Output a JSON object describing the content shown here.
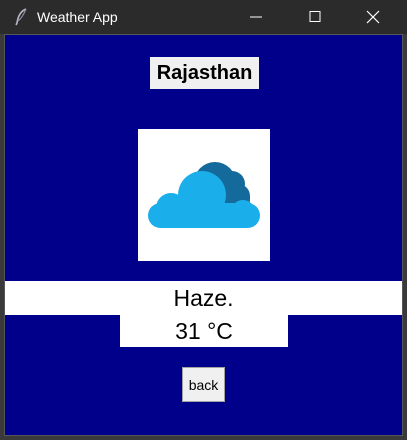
{
  "window": {
    "title": "Weather App",
    "icon": "feather-icon",
    "controls": [
      "minimize-icon",
      "maximize-icon",
      "close-icon"
    ]
  },
  "weather": {
    "city": "Rajasthan",
    "condition": "Haze.",
    "temperature": "31 °C",
    "icon": "cloud-icon"
  },
  "buttons": {
    "back_label": "back"
  },
  "colors": {
    "titlebar": "#2b2b2b",
    "background": "#00008a",
    "panel": "#ffffff",
    "label_bg": "#f0f0f0",
    "cloud_front": "#1aafea",
    "cloud_back": "#146a9a"
  }
}
